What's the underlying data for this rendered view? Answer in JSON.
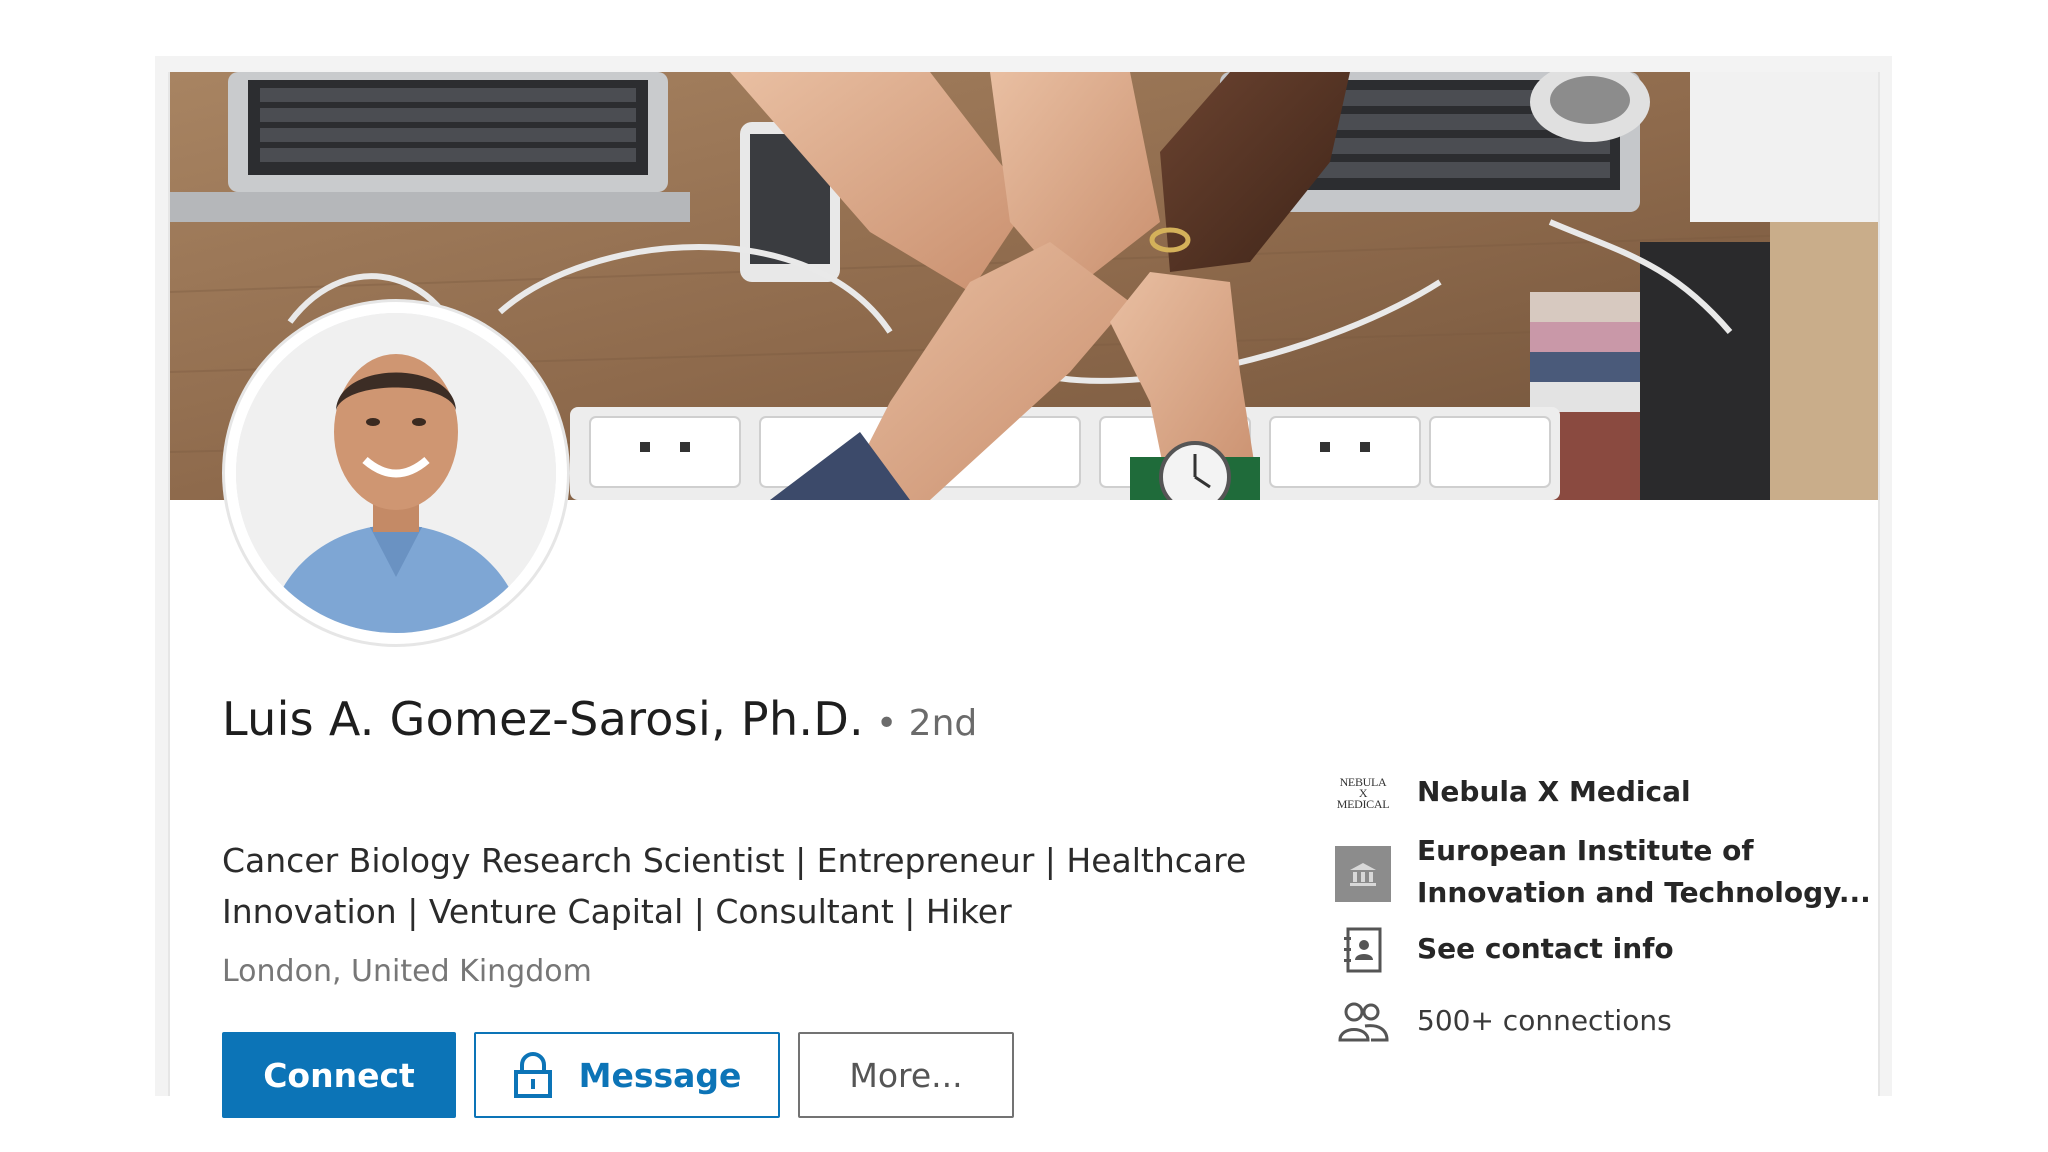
{
  "profile": {
    "name": "Luis A. Gomez-Sarosi, Ph.D.",
    "degree": "• 2nd",
    "headline_line1": "Cancer Biology Research Scientist | Entrepreneur | Healthcare",
    "headline_line2": "Innovation | Venture Capital | Consultant | Hiker",
    "location": "London, United Kingdom"
  },
  "actions": {
    "connect_label": "Connect",
    "message_label": "Message",
    "more_label": "More..."
  },
  "sidebar": {
    "company": "Nebula X Medical",
    "company_logo_line1": "NEBULA X",
    "company_logo_line2": "MEDICAL",
    "school_line1": "European Institute of",
    "school_line2": "Innovation and Technology...",
    "contact_info": "See contact info",
    "connections": "500+ connections"
  },
  "colors": {
    "accent": "#0c74b7",
    "text_primary": "#1e1e1e",
    "text_secondary": "#777777"
  },
  "icons": {
    "lock": "lock-icon",
    "school": "school-icon",
    "contact": "contact-card-icon",
    "connections": "people-icon"
  }
}
